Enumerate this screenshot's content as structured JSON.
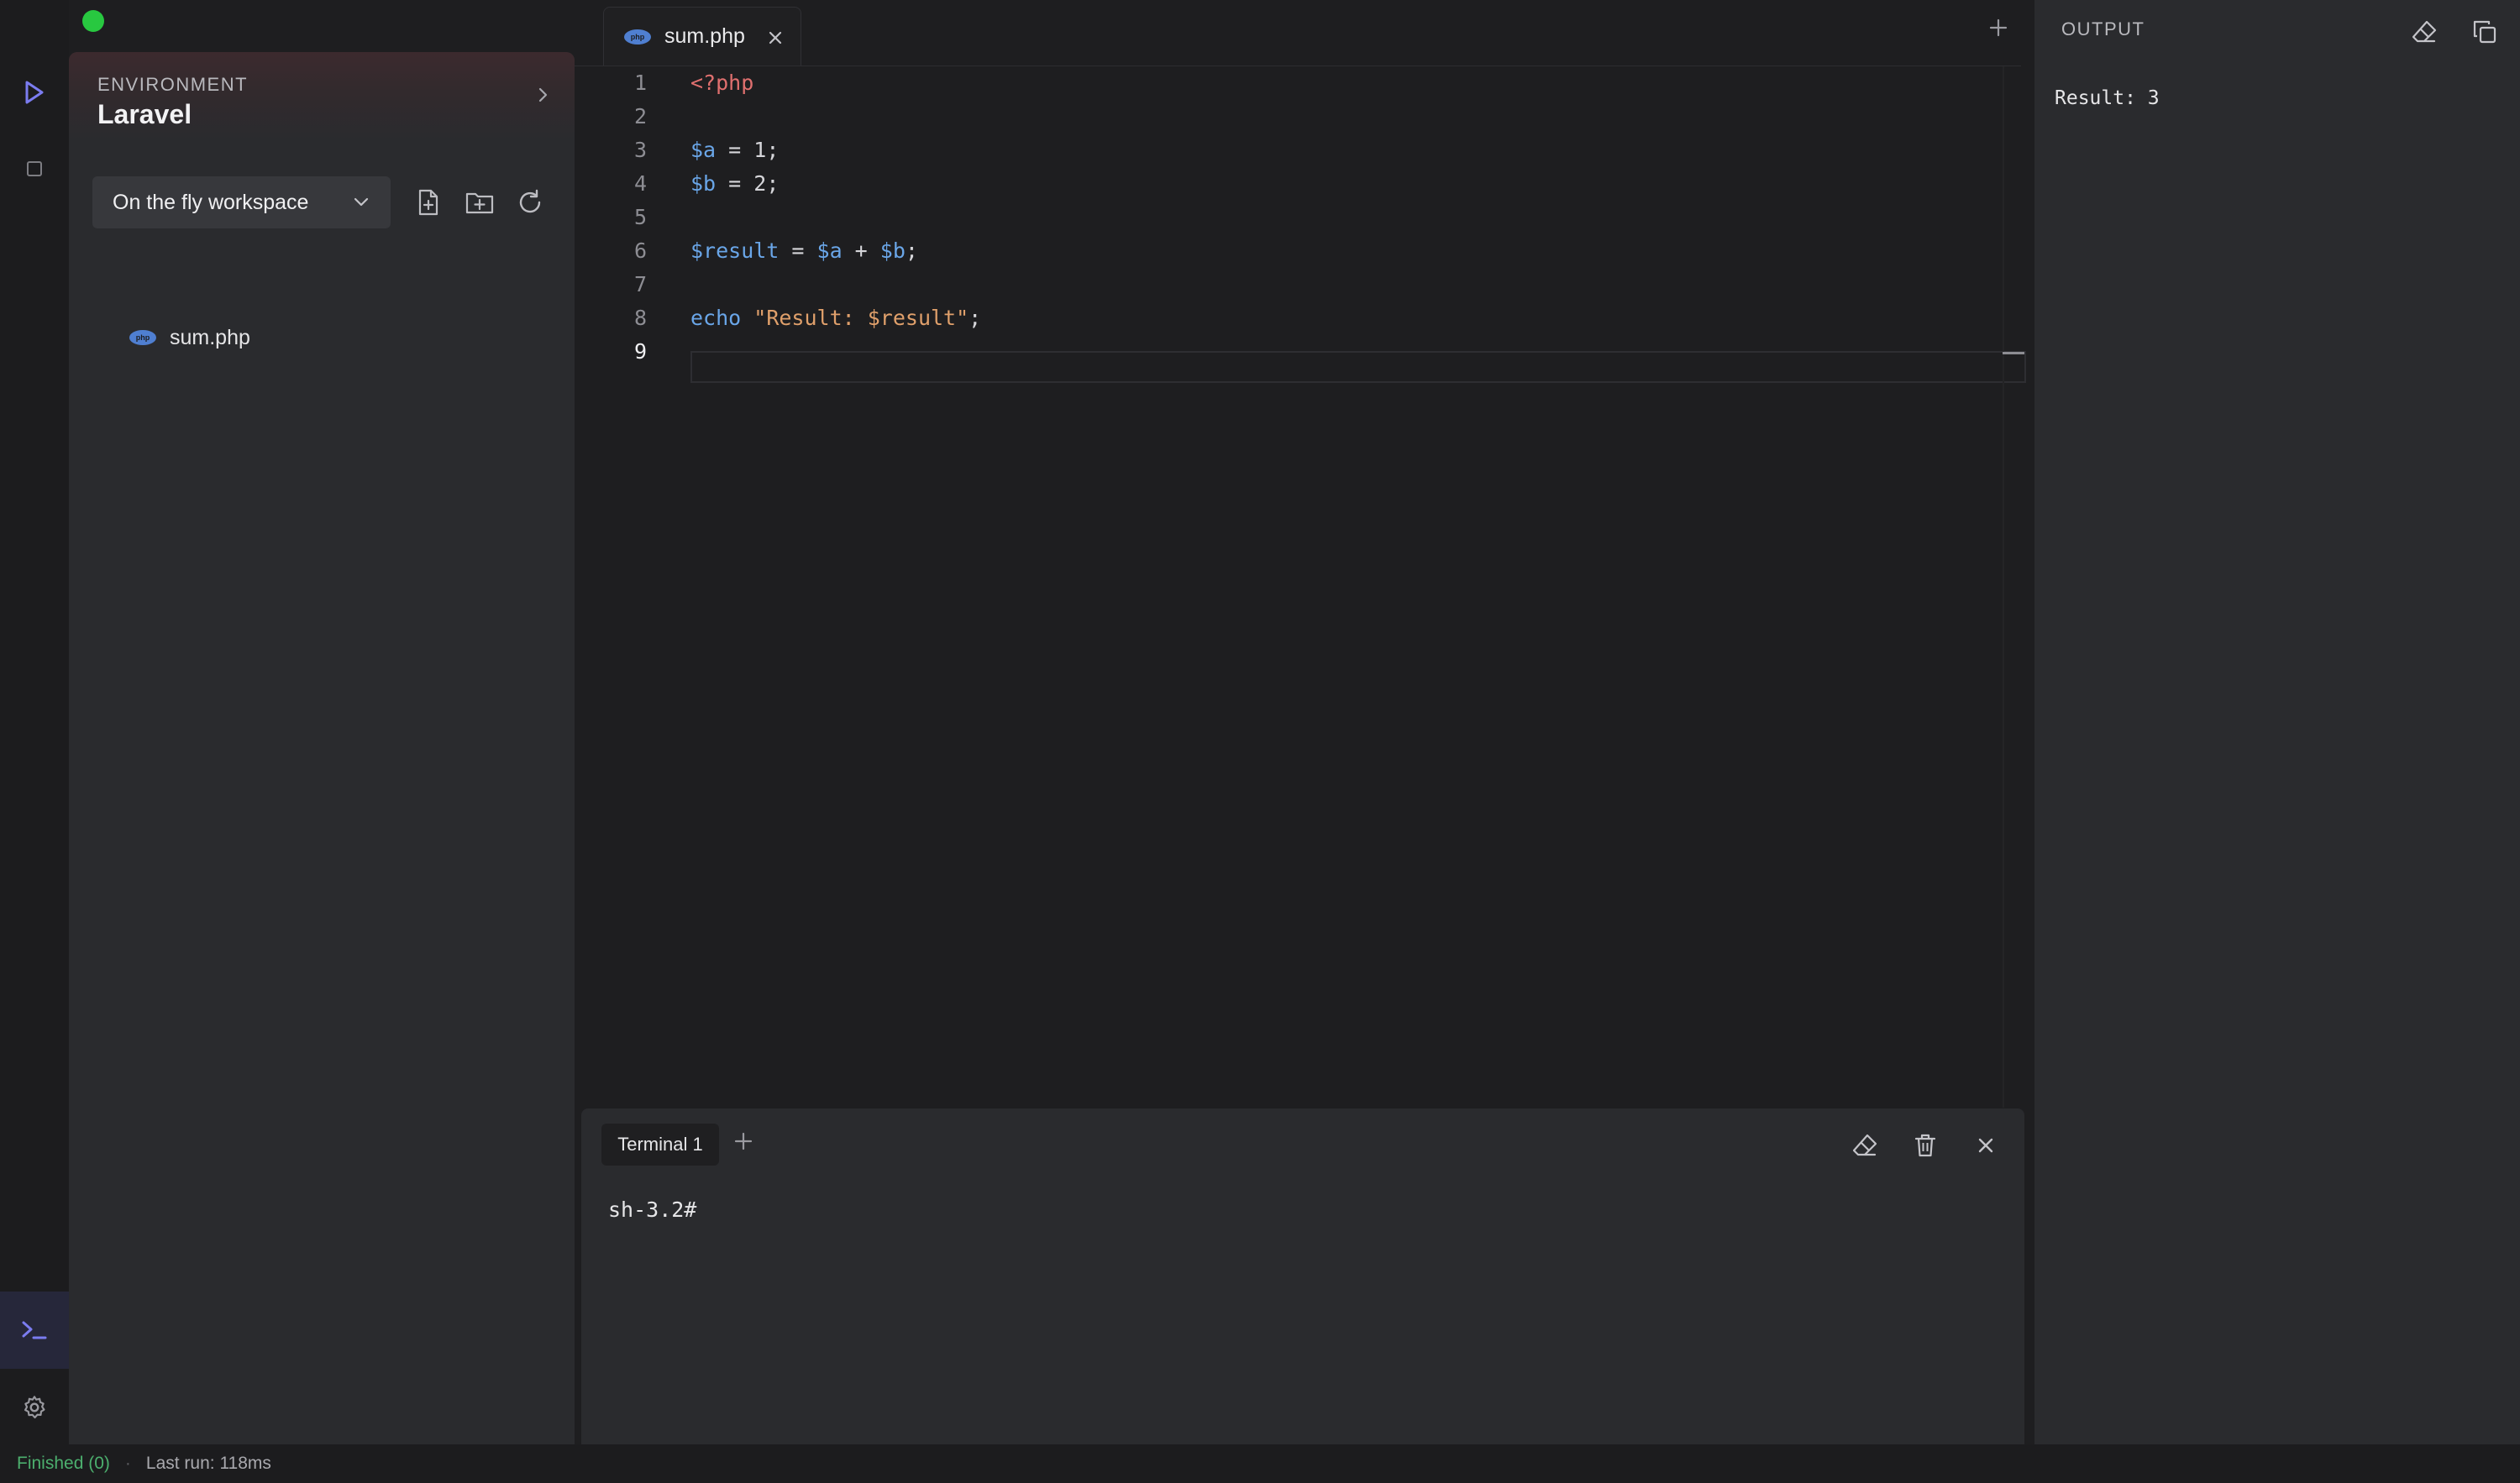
{
  "window": {
    "controls": {
      "close_color": "#ff5f57",
      "minimize_color": "#febc2e",
      "zoom_color": "#28c840"
    }
  },
  "activity_bar": {
    "items": [
      {
        "icon": "run-icon",
        "color": "#7b7cf0"
      },
      {
        "icon": "stop-icon"
      },
      {
        "icon": "terminal-icon",
        "color": "#7b7cf0",
        "active": true
      },
      {
        "icon": "gear-icon"
      }
    ]
  },
  "sidebar": {
    "environment_label": "ENVIRONMENT",
    "environment_name": "Laravel",
    "workspace": "On the fly workspace",
    "tools": [
      "new-file-icon",
      "new-folder-icon",
      "refresh-icon"
    ],
    "files": [
      {
        "name": "sum.php",
        "icon": "php-icon",
        "badge": "php"
      }
    ]
  },
  "editor": {
    "tab": {
      "label": "sum.php",
      "badge": "php"
    },
    "lines": [
      {
        "n": "1",
        "tokens": [
          {
            "t": "<?php",
            "c": "tag"
          }
        ]
      },
      {
        "n": "2",
        "tokens": []
      },
      {
        "n": "3",
        "tokens": [
          {
            "t": "$a",
            "c": "var"
          },
          {
            "t": " = 1;",
            "c": "plain"
          }
        ]
      },
      {
        "n": "4",
        "tokens": [
          {
            "t": "$b",
            "c": "var"
          },
          {
            "t": " = 2;",
            "c": "plain"
          }
        ]
      },
      {
        "n": "5",
        "tokens": []
      },
      {
        "n": "6",
        "tokens": [
          {
            "t": "$result",
            "c": "var"
          },
          {
            "t": " = ",
            "c": "plain"
          },
          {
            "t": "$a",
            "c": "var"
          },
          {
            "t": " + ",
            "c": "plain"
          },
          {
            "t": "$b",
            "c": "var"
          },
          {
            "t": ";",
            "c": "plain"
          }
        ]
      },
      {
        "n": "7",
        "tokens": []
      },
      {
        "n": "8",
        "tokens": [
          {
            "t": "echo",
            "c": "kw"
          },
          {
            "t": " ",
            "c": "plain"
          },
          {
            "t": "\"Result: $result\"",
            "c": "str"
          },
          {
            "t": ";",
            "c": "plain"
          }
        ]
      },
      {
        "n": "9",
        "tokens": [],
        "active": true
      }
    ]
  },
  "terminal": {
    "tab_label": "Terminal 1",
    "prompt": "sh-3.2#"
  },
  "output": {
    "title": "OUTPUT",
    "text": "Result: 3"
  },
  "status": {
    "finished": "Finished (0)",
    "separator": "·",
    "last_run": "Last run: 118ms",
    "finished_color": "#4caf6e"
  }
}
